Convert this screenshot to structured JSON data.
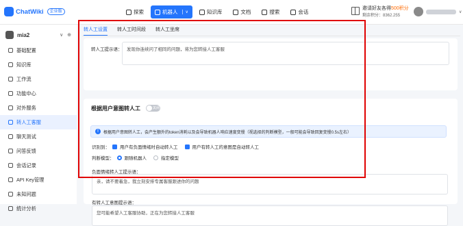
{
  "colors": {
    "accent": "#2475fc",
    "highlight_frame": "#e00000",
    "invite_accent": "#ff6a00"
  },
  "app": {
    "name": "ChatWiki",
    "badge": "企业版"
  },
  "nav": {
    "items": [
      {
        "label": "探索",
        "icon": "compass-icon"
      },
      {
        "label": "机器人",
        "icon": "robot-icon",
        "active": true
      },
      {
        "label": "知识库",
        "icon": "book-icon"
      },
      {
        "label": "文档",
        "icon": "document-icon"
      },
      {
        "label": "搜索",
        "icon": "search-icon"
      },
      {
        "label": "会话",
        "icon": "chat-icon"
      }
    ]
  },
  "invite": {
    "prefix": "邀请好友各得",
    "highlight": "500积分",
    "points_label": "剩余积分：8362.255"
  },
  "robot": {
    "name": "mia2",
    "controls": "∨ ⊕"
  },
  "sidebar": {
    "items": [
      {
        "label": "基础配置",
        "icon": "settings-icon"
      },
      {
        "label": "知识库",
        "icon": "book-icon"
      },
      {
        "label": "工作流",
        "icon": "workflow-icon"
      },
      {
        "label": "功能中心",
        "icon": "function-icon"
      },
      {
        "label": "对外服务",
        "icon": "service-icon"
      },
      {
        "label": "转人工客服",
        "icon": "headset-icon",
        "active": true
      },
      {
        "label": "聊天测试",
        "icon": "test-icon"
      },
      {
        "label": "问答反馈",
        "icon": "feedback-icon"
      },
      {
        "label": "会话记录",
        "icon": "history-icon"
      },
      {
        "label": "API Key管理",
        "icon": "key-icon"
      },
      {
        "label": "未知问题",
        "icon": "question-icon"
      },
      {
        "label": "统计分析",
        "icon": "chart-icon"
      }
    ]
  },
  "tabs": [
    {
      "label": "转人工设置",
      "active": true
    },
    {
      "label": "转人工时间段"
    },
    {
      "label": "转人工坐席"
    }
  ],
  "transfer_prompt": {
    "label": "转人工提示语：",
    "value": "发现你连续问了相同的问题，将为您转接人工客服"
  },
  "intent_section": {
    "title": "根据用户意图转人工",
    "toggle_label": "关闭",
    "info": "根据用户意图转人工，会产生额外的token消耗以及会导致机器人响应速度变慢（视选择的判断模型，一般可能会导致回复变慢0.5s左右）",
    "recognize_label": "识别到：",
    "options": [
      "用户有负面情绪时自动转人工",
      "用户有转人工的意图是自动转人工"
    ],
    "model_label": "判断模型：",
    "models": [
      {
        "label": "跟随机器人",
        "selected": true
      },
      {
        "label": "指定模型",
        "selected": false
      }
    ],
    "negative_prompt": {
      "label": "负面情绪转人工提示语：",
      "value": "亲，请不要着急，我立刻安排专属客服跟进你的问题"
    },
    "intent_prompt": {
      "label": "有转人工意图提示语：",
      "value": "您可能希望人工客服协助，正在为您转接人工客服"
    }
  }
}
